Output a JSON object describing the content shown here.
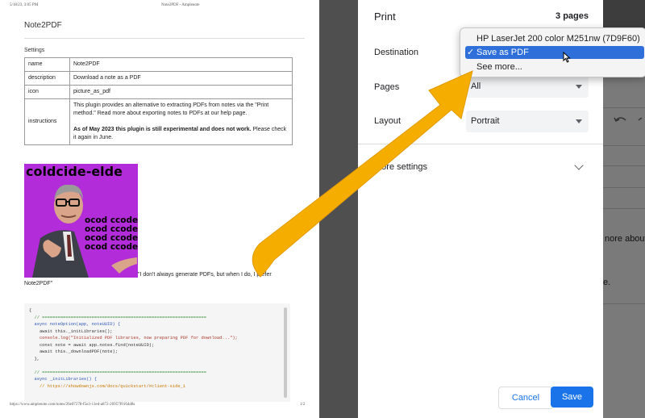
{
  "preview": {
    "header_left": "5/18/23, 3:05 PM",
    "header_center": "Note2PDF - Amplenote",
    "doc_title": "Note2PDF",
    "settings_heading": "Settings",
    "rows": [
      {
        "key": "name",
        "value": "Note2PDF"
      },
      {
        "key": "description",
        "value": "Download a note as a PDF"
      },
      {
        "key": "icon",
        "value": "picture_as_pdf"
      },
      {
        "key": "instructions",
        "value": "This plugin provides an alternative to extracting PDFs from notes via the \"Print method.\" Read more about exporting notes to PDFs at our help page.",
        "note_bold": "As of May 2023 this plugin is still experimental and does not work.",
        "note_rest": " Please check it again in June."
      }
    ],
    "meme_top_text": "coldcide-elde",
    "meme_block_text": [
      "ocod ccode",
      "ocod ccode",
      "ocod ccode",
      "ocod ccode"
    ],
    "caption_line1": "\"I don't always generate PDFs, but when I do, I prefer",
    "caption_line2": "Note2PDF\"",
    "code_lines": [
      "{",
      "  // ===============================================================",
      "  async noteOption(app, noteUUID) {",
      "    await this._initLibraries();",
      "    console.log(\"Initialized PDF libraries, now preparing PDF for download...\");",
      "    const note = await app.notes.find(noteUUID);",
      "    await this._downloadPDF(note);",
      "  },",
      "",
      "  // ===============================================================",
      "  async _initLibraries() {",
      "    // https://showdownjs.com/docs/quickstart/#client-side_1"
    ],
    "footer_url": "https://www.amplenote.com/notes/26e07278-f5e3-11ed-a872-26957f0164d8s",
    "footer_page": "1/2"
  },
  "print": {
    "title": "Print",
    "page_count": "3 pages",
    "destination_label": "Destination",
    "pages_label": "Pages",
    "pages_value": "All",
    "layout_label": "Layout",
    "layout_value": "Portrait",
    "more_settings": "More settings",
    "cancel": "Cancel",
    "save": "Save"
  },
  "dropdown": {
    "items": [
      {
        "label": "HP LaserJet 200 color M251nw (7D9F60)",
        "selected": false
      },
      {
        "label": "Save as PDF",
        "selected": true
      },
      {
        "label": "See more...",
        "selected": false
      }
    ],
    "check": "✓"
  },
  "background_app": {
    "fragment1": "nore about e",
    "fragment2": "e."
  },
  "colors": {
    "accent_blue": "#1a73e8",
    "arrow_orange": "#f5ad00",
    "meme_purple": "#b32cd9",
    "dropdown_selected": "#2e6fd9"
  }
}
